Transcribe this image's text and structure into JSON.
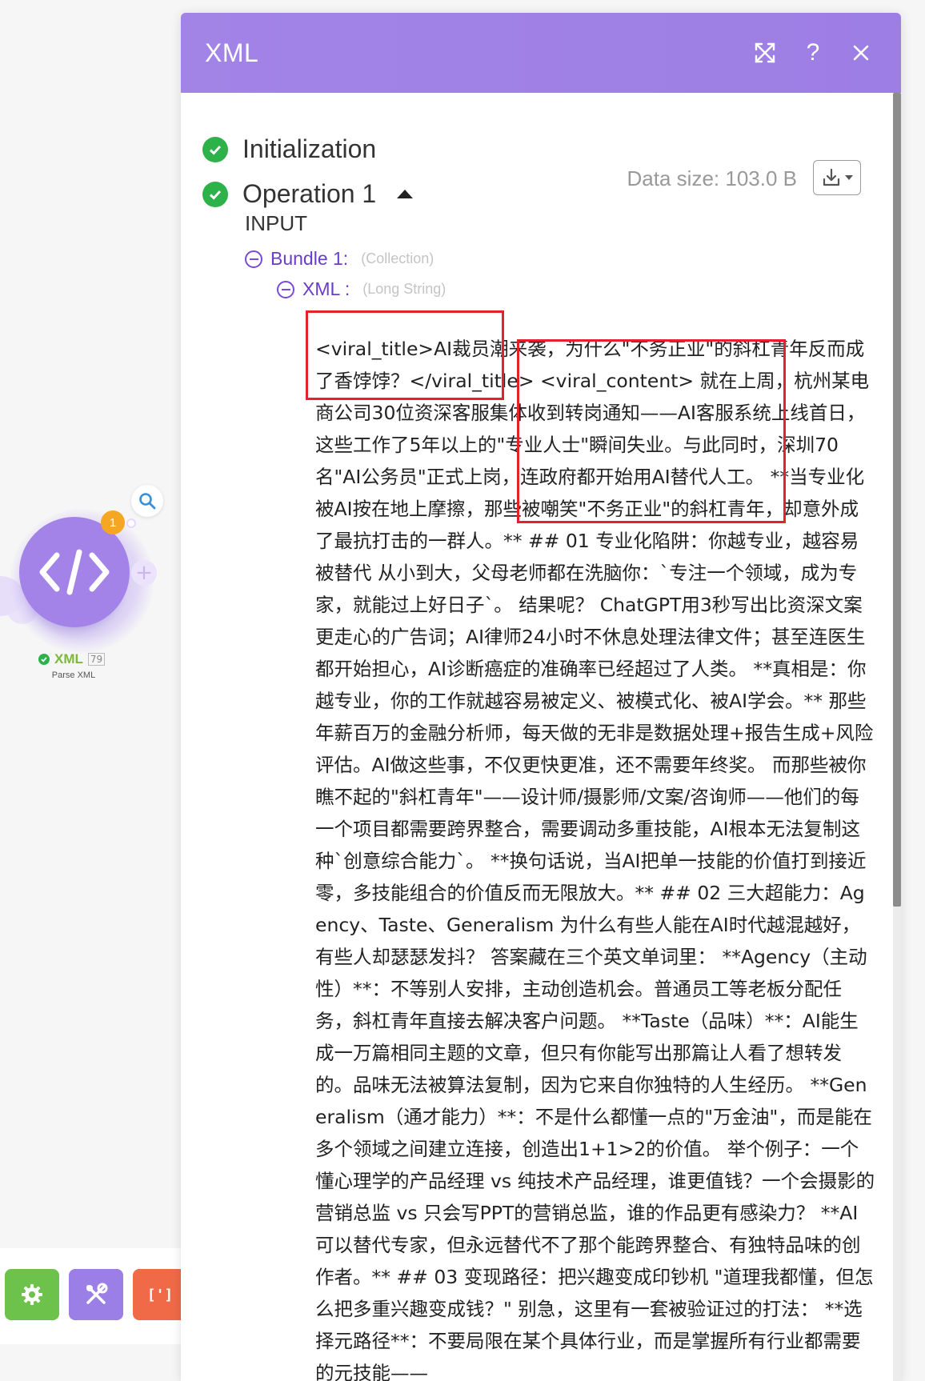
{
  "dialog": {
    "title": "XML",
    "icons": {
      "expand": "expand-arrows-icon",
      "help": "question-mark-icon",
      "close": "close-icon"
    },
    "help_label": "?",
    "accent_color": "#a283e6",
    "steps": [
      {
        "label": "Initialization",
        "status": "success"
      },
      {
        "label": "Operation 1",
        "status": "success",
        "expanded": true
      }
    ],
    "data_size": "Data size: 103.0 B",
    "section": "INPUT",
    "bundle": {
      "key": "Bundle 1:",
      "type": "(Collection)"
    },
    "field": {
      "key": "XML :",
      "type": "(Long String)"
    },
    "xml_value": "<viral_title>AI裁员潮来袭，为什么\"不务正业\"的斜杠青年反而成了香饽饽？</viral_title> <viral_content> 就在上周，杭州某电商公司30位资深客服集体收到转岗通知——AI客服系统上线首日，这些工作了5年以上的\"专业人士\"瞬间失业。与此同时，深圳70名\"AI公务员\"正式上岗，连政府都开始用AI替代人工。 **当专业化被AI按在地上摩擦，那些被嘲笑\"不务正业\"的斜杠青年，却意外成了最抗打击的一群人。** ## 01 专业化陷阱：你越专业，越容易被替代 从小到大，父母老师都在洗脑你：`专注一个领域，成为专家，就能过上好日子`。 结果呢？ ChatGPT用3秒写出比资深文案更走心的广告词；AI律师24小时不休息处理法律文件；甚至连医生都开始担心，AI诊断癌症的准确率已经超过了人类。 **真相是：你越专业，你的工作就越容易被定义、被模式化、被AI学会。** 那些年薪百万的金融分析师，每天做的无非是数据处理+报告生成+风险评估。AI做这些事，不仅更快更准，还不需要年终奖。 而那些被你瞧不起的\"斜杠青年\"——设计师/摄影师/文案/咨询师——他们的每一个项目都需要跨界整合，需要调动多重技能，AI根本无法复制这种`创意综合能力`。 **换句话说，当AI把单一技能的价值打到接近零，多技能组合的价值反而无限放大。** ## 02 三大超能力：Agency、Taste、Generalism 为什么有些人能在AI时代越混越好，有些人却瑟瑟发抖？ 答案藏在三个英文单词里： **Agency（主动性）**：不等别人安排，主动创造机会。普通员工等老板分配任务，斜杠青年直接去解决客户问题。 **Taste（品味）**：AI能生成一万篇相同主题的文章，但只有你能写出那篇让人看了想转发的。品味无法被算法复制，因为它来自你独特的人生经历。 **Generalism（通才能力）**：不是什么都懂一点的\"万金油\"，而是能在多个领域之间建立连接，创造出1+1>2的价值。 举个例子：一个懂心理学的产品经理 vs 纯技术产品经理，谁更值钱？一个会摄影的营销总监 vs 只会写PPT的营销总监，谁的作品更有感染力？ **AI可以替代专家，但永远替代不了那个能跨界整合、有独特品味的创作者。** ## 03 变现路径：把兴趣变成印钞机 \"道理我都懂，但怎么把多重兴趣变成钱？\" 别急，这里有一套被验证过的打法： **选择元路径**：不要局限在某个具体行业，而是掌握所有行业都需要的元技能——"
  },
  "canvas": {
    "module": {
      "name": "XML",
      "id": "79",
      "subtitle": "Parse XML",
      "icon": "code-brackets-icon",
      "color": "#a383e8",
      "status": "success"
    },
    "operations_badge": "1",
    "inspect_icon": "search-icon",
    "add_icon": "plus-icon"
  },
  "toolbar": {
    "buttons": [
      {
        "icon": "gear-icon",
        "color": "#6cc24a"
      },
      {
        "icon": "tools-icon",
        "color": "#9b7fe6"
      },
      {
        "icon": "flow-control-icon",
        "label": "[']",
        "color": "#f06a47"
      }
    ]
  }
}
